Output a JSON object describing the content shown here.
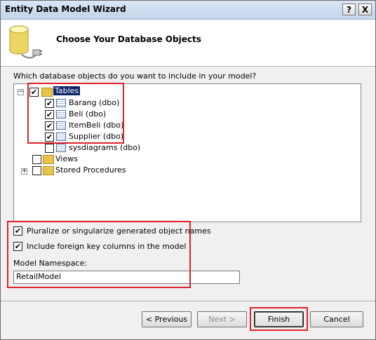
{
  "window": {
    "title": "Entity Data Model Wizard",
    "help_glyph": "?",
    "close_glyph": "X"
  },
  "header": {
    "title": "Choose Your Database Objects",
    "icon": "database-plug-icon"
  },
  "question": "Which database objects do you want to include in your model?",
  "tree": {
    "tables": {
      "label": "Tables",
      "checked": true,
      "expanded": true,
      "items": [
        {
          "label": "Barang (dbo)",
          "checked": true
        },
        {
          "label": "Beli (dbo)",
          "checked": true
        },
        {
          "label": "ItemBeli (dbo)",
          "checked": true
        },
        {
          "label": "Supplier (dbo)",
          "checked": true
        },
        {
          "label": "sysdiagrams (dbo)",
          "checked": false
        }
      ]
    },
    "views": {
      "label": "Views",
      "checked": false
    },
    "stored_procedures": {
      "label": "Stored Procedures",
      "checked": false,
      "expanded": false
    }
  },
  "options": {
    "pluralize": {
      "label": "Pluralize or singularize generated object names",
      "checked": true
    },
    "foreign_keys": {
      "label": "Include foreign key columns in the model",
      "checked": true
    }
  },
  "namespace": {
    "label": "Model Namespace:",
    "value": "RetailModel"
  },
  "buttons": {
    "previous": "< Previous",
    "next": "Next >",
    "finish": "Finish",
    "cancel": "Cancel"
  },
  "colors": {
    "highlight_border": "#e0222a",
    "selection_bg": "#0a246a"
  }
}
